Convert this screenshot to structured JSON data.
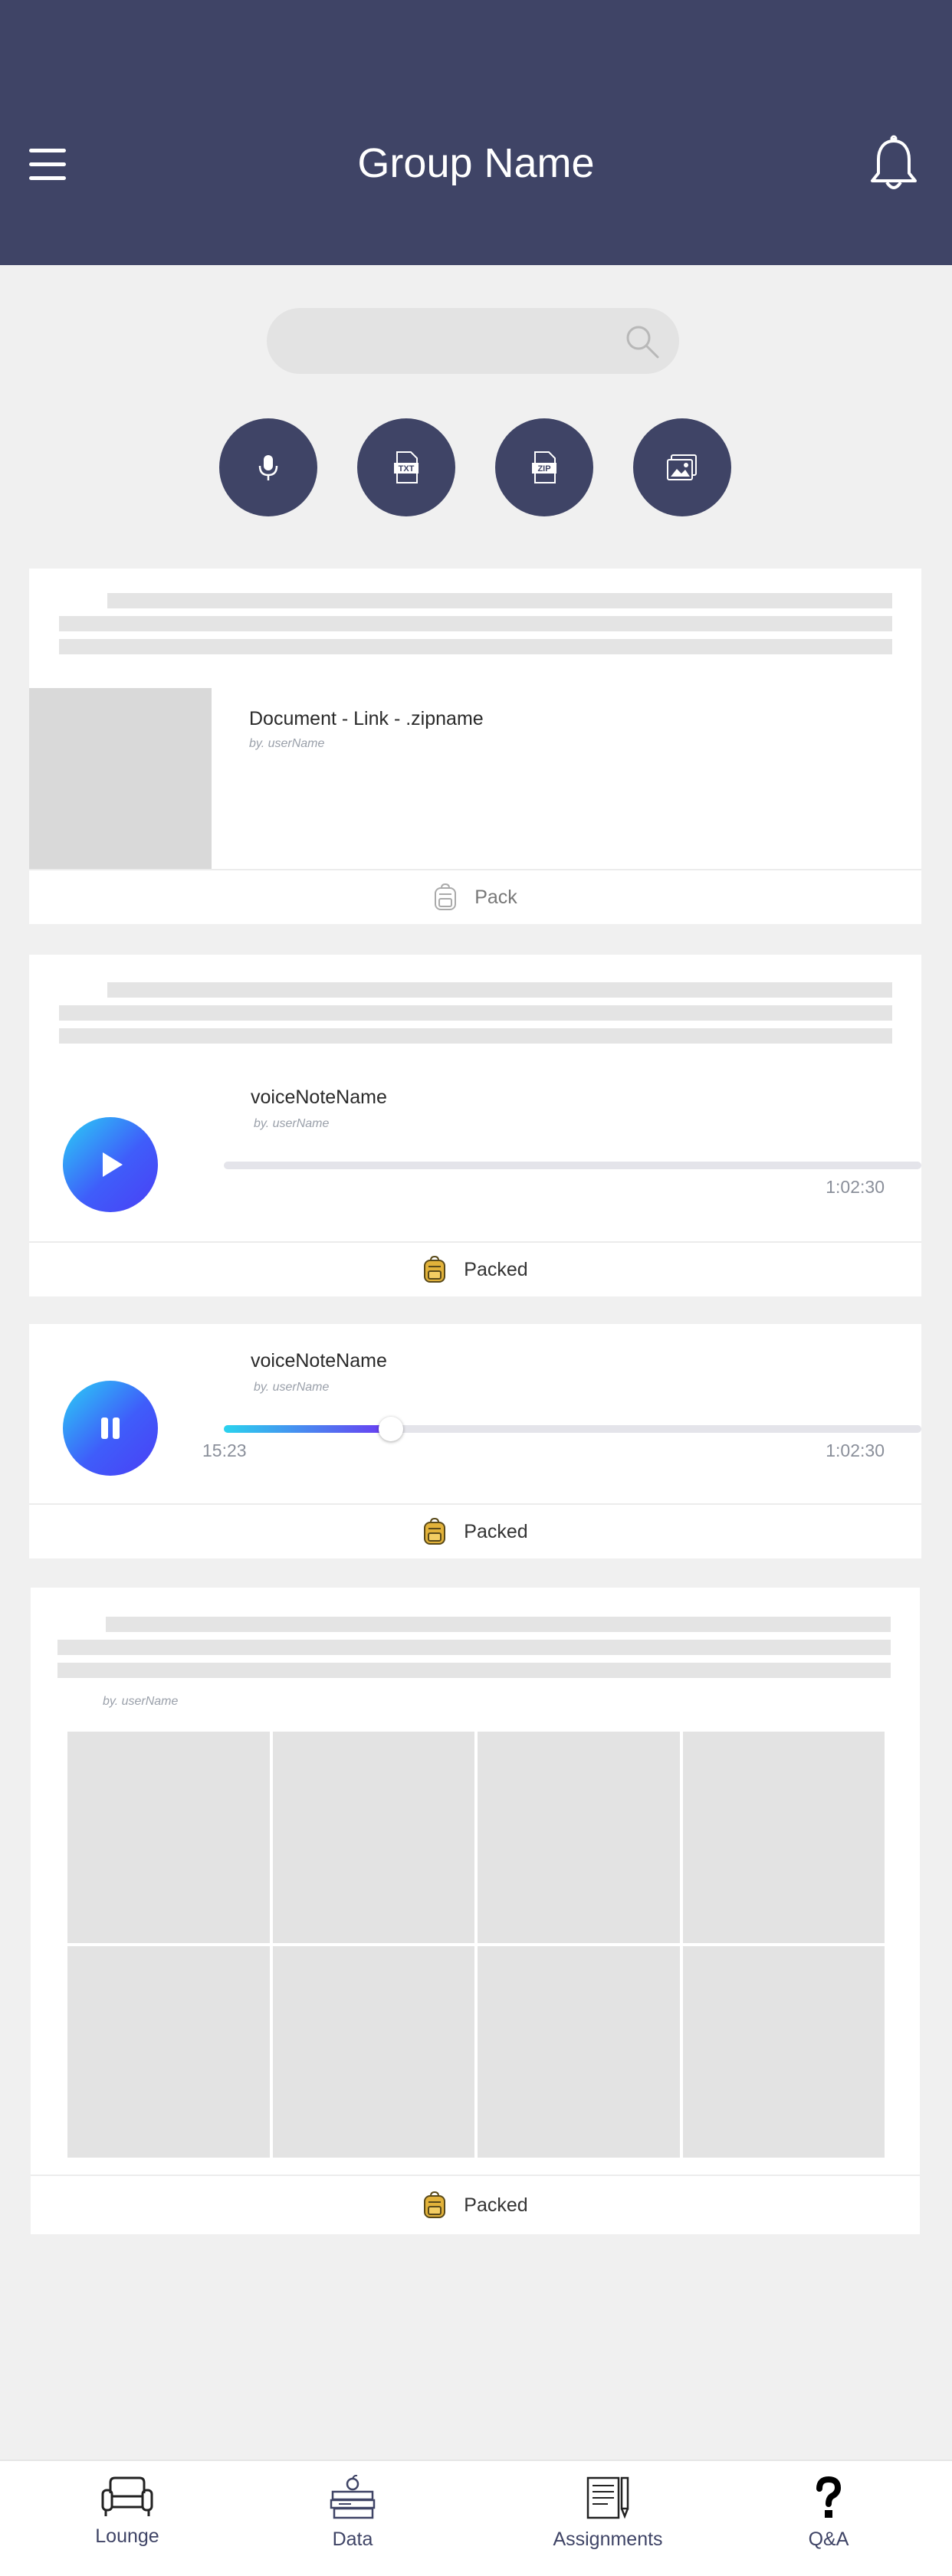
{
  "header": {
    "title": "Group Name"
  },
  "search": {
    "placeholder": ""
  },
  "actions": [
    {
      "icon": "microphone-icon"
    },
    {
      "icon": "txt-file-icon",
      "badge": "TXT"
    },
    {
      "icon": "zip-file-icon",
      "badge": "ZIP"
    },
    {
      "icon": "gallery-icon"
    }
  ],
  "posts": {
    "document": {
      "title": "Document - Link - .zipname",
      "byline": "by. userName",
      "footer_label": "Pack"
    },
    "voice_idle": {
      "title": "voiceNoteName",
      "byline": "by. userName",
      "duration": "1:02:30",
      "progress": 0,
      "footer_label": "Packed"
    },
    "voice_playing": {
      "title": "voiceNoteName",
      "byline": "by. userName",
      "elapsed": "15:23",
      "duration": "1:02:30",
      "progress": 0.24,
      "footer_label": "Packed"
    },
    "gallery": {
      "byline": "by. userName",
      "footer_label": "Packed",
      "image_count": 8
    }
  },
  "bottom_nav": [
    {
      "label": "Lounge",
      "icon": "sofa-icon"
    },
    {
      "label": "Data",
      "icon": "books-icon"
    },
    {
      "label": "Assignments",
      "icon": "notepad-pencil-icon"
    },
    {
      "label": "Q&A",
      "icon": "question-mark-icon"
    }
  ],
  "colors": {
    "header": "#3f4466",
    "background": "#f0f0f0",
    "accent_start": "#2ad0f5",
    "accent_end": "#4a3ff5"
  }
}
